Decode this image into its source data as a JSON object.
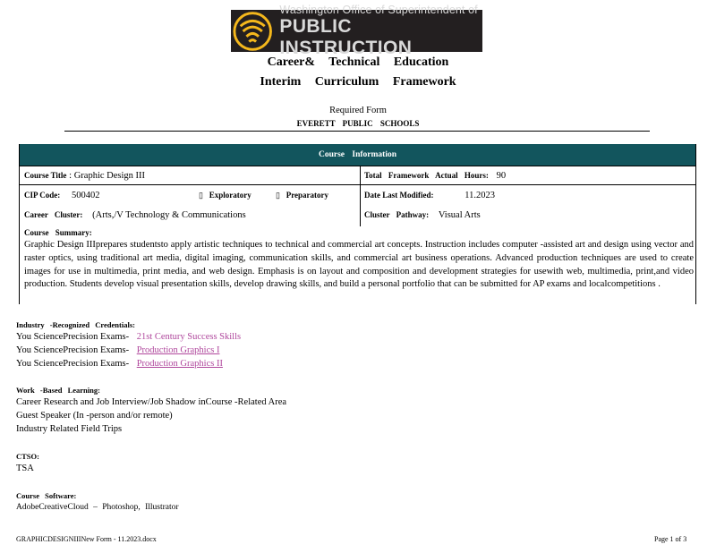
{
  "header": {
    "logo_line1": "Washington Office of Superintendent of",
    "logo_line2": "PUBLIC INSTRUCTION",
    "title_line1": "Career& Technical Education",
    "title_line2": "Interim Curriculum Framework",
    "required_form": "Required Form",
    "school": "EVERETT PUBLIC SCHOOLS"
  },
  "course_info": {
    "header": "Course Information",
    "course_title_label": "Course Title",
    "course_title_value": ": Graphic Design III",
    "total_hours_label": "Total Framework Actual Hours:",
    "total_hours_value": "90",
    "cip_label": "CIP Code:",
    "cip_value": "500402",
    "exploratory_box": "▯",
    "exploratory_label": "Exploratory",
    "preparatory_box": "▯",
    "preparatory_label": "Preparatory",
    "date_label": "Date Last Modified:",
    "date_value": "11.2023",
    "cluster_label": "Career Cluster:",
    "cluster_value": "(Arts,/V Technology & Communications",
    "pathway_label": "Cluster Pathway:",
    "pathway_value": "Visual Arts",
    "summary_label": "Course Summary:",
    "summary_text": "Graphic Design IIIprepares studentsto apply artistic techniques to technical and commercial art concepts. Instruction includes computer -assisted art and design using vector and raster optics, using traditional art media, digital imaging, communication skills, and commercial art business operations. Advanced production techniques are used to create images for use in multimedia, print media, and web design. Emphasis is on layout and composition and development strategies for usewith web, multimedia, print,and video production. Students develop visual presentation skills, develop drawing skills, and build a personal portfolio that can be submitted for AP exams and localcompetitions ."
  },
  "credentials": {
    "title": "Industry -Recognized Credentials:",
    "items": [
      {
        "prefix": "You SciencePrecision Exams-",
        "link": "21st Century Success Skills"
      },
      {
        "prefix": "You SciencePrecision Exams-",
        "link": "Production Graphics I"
      },
      {
        "prefix": "You SciencePrecision Exams-",
        "link": "Production Graphics II"
      }
    ]
  },
  "work_based": {
    "title": "Work -Based Learning:",
    "items": [
      "Career Research and Job Interview/Job Shadow inCourse -Related Area",
      "Guest Speaker (In -person and/or remote)",
      "Industry Related Field Trips"
    ]
  },
  "ctso": {
    "title": "CTSO:",
    "value": "TSA"
  },
  "software": {
    "title": "Course Software:",
    "value": "AdobeCreativeCloud – Photoshop, Illustrator"
  },
  "footer": {
    "filename": "GRAPHICDESIGNIIINew Form - 11.2023.docx",
    "page": "Page 1 of 3"
  },
  "colors": {
    "header_bg": "#12555d",
    "link": "#b0489d",
    "logo_bg": "#231f20",
    "logo_gold": "#f5b81c"
  }
}
